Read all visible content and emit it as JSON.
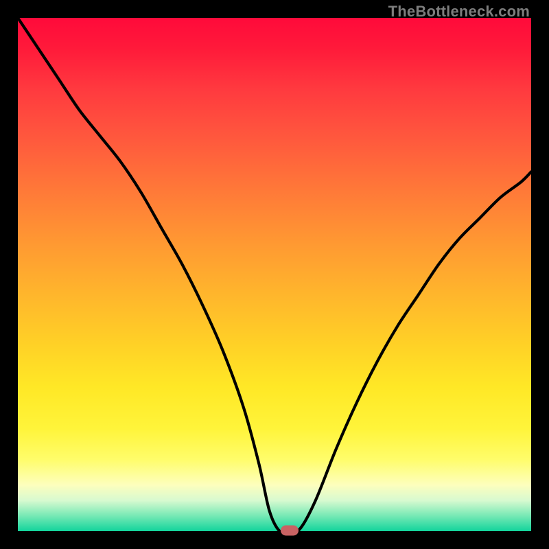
{
  "watermark": "TheBottleneck.com",
  "colors": {
    "frame": "#000000",
    "curve": "#000000",
    "marker": "#c96263"
  },
  "chart_data": {
    "type": "line",
    "title": "",
    "xlabel": "",
    "ylabel": "",
    "xlim": [
      0,
      100
    ],
    "ylim": [
      0,
      100
    ],
    "grid": false,
    "x": [
      0,
      4,
      8,
      12,
      16,
      20,
      24,
      28,
      32,
      36,
      40,
      44,
      47,
      49,
      51,
      53,
      55,
      58,
      62,
      66,
      70,
      74,
      78,
      82,
      86,
      90,
      94,
      98,
      100
    ],
    "values": [
      100,
      94,
      88,
      82,
      77,
      72,
      66,
      59,
      52,
      44,
      35,
      24,
      13,
      4,
      0,
      0,
      0.5,
      6,
      16,
      25,
      33,
      40,
      46,
      52,
      57,
      61,
      65,
      68,
      70
    ],
    "marker": {
      "x": 53,
      "y": 0
    },
    "background": "red-yellow-green vertical gradient"
  }
}
